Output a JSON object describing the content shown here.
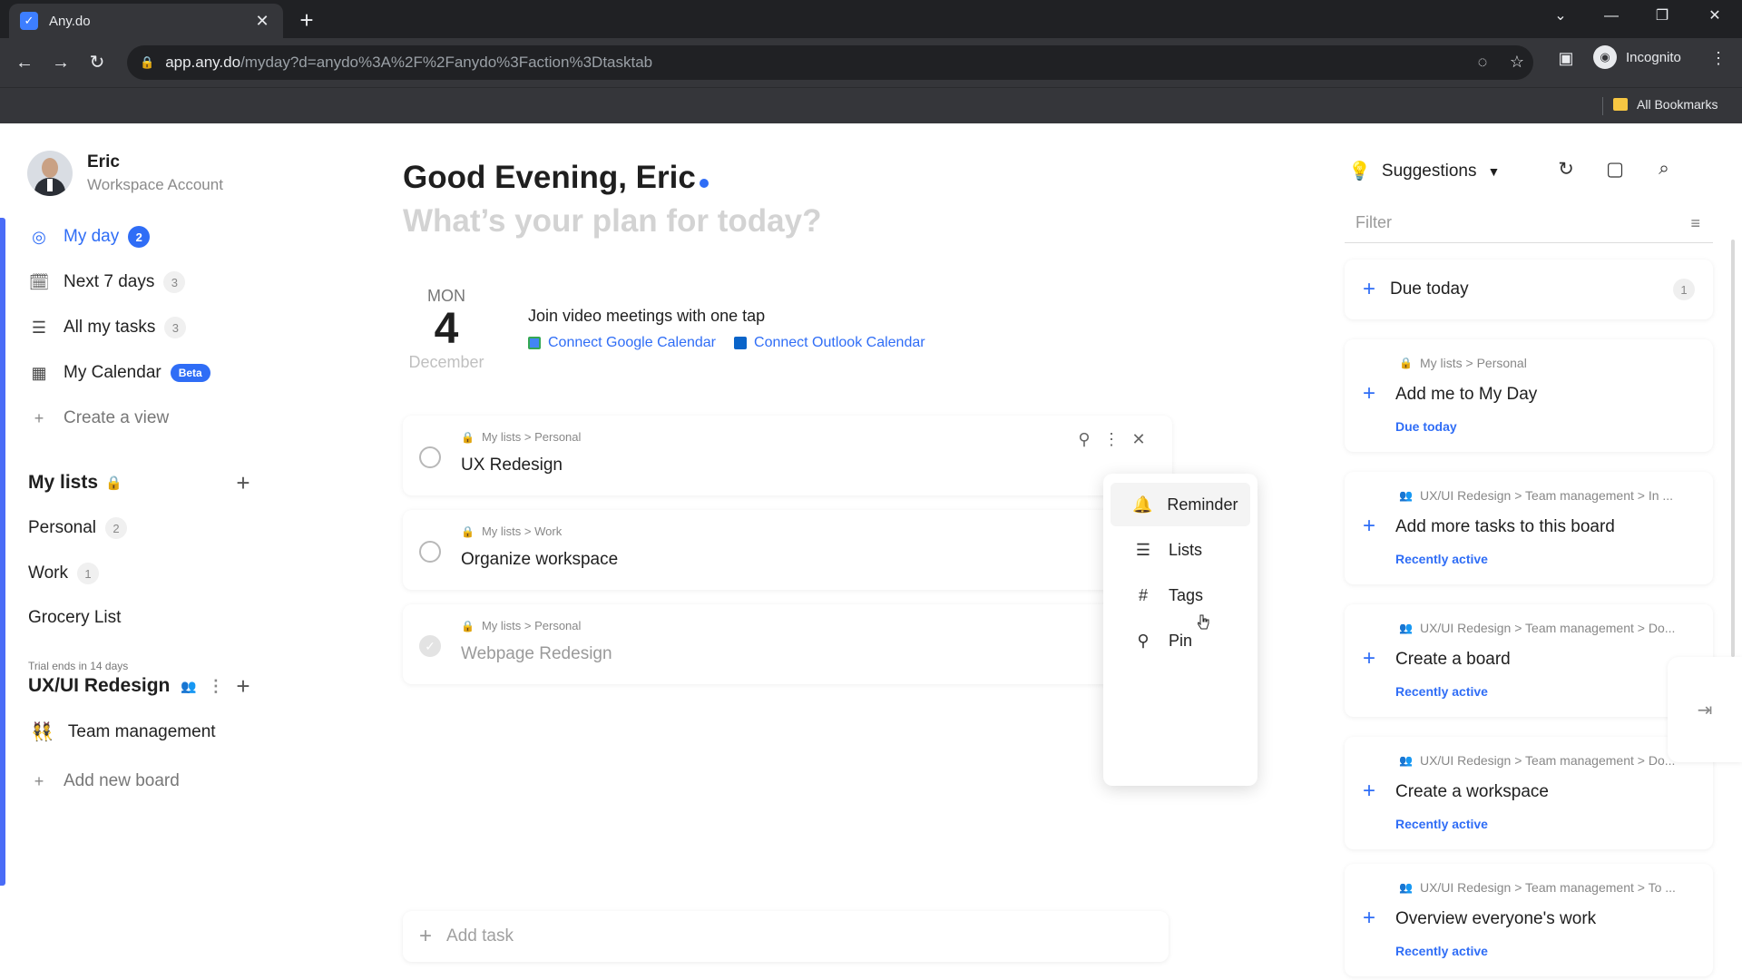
{
  "browser": {
    "tab_title": "Any.do",
    "url_host": "app.any.do",
    "url_path": "/myday?d=anydo%3A%2F%2Fanydo%3Faction%3Dtasktab",
    "incognito_label": "Incognito",
    "bookmarks_label": "All Bookmarks"
  },
  "user": {
    "name": "Eric",
    "account_type": "Workspace Account"
  },
  "nav": {
    "my_day": {
      "label": "My day",
      "count": "2"
    },
    "next_7_days": {
      "label": "Next 7 days",
      "count": "3"
    },
    "all_my_tasks": {
      "label": "All my tasks",
      "count": "3"
    },
    "my_calendar": {
      "label": "My Calendar",
      "badge": "Beta"
    },
    "create_view": "Create a view"
  },
  "my_lists": {
    "title": "My lists",
    "items": [
      {
        "label": "Personal",
        "count": "2"
      },
      {
        "label": "Work",
        "count": "1"
      },
      {
        "label": "Grocery List"
      }
    ]
  },
  "workspace": {
    "trial_text": "Trial ends in 14 days",
    "name": "UX/UI Redesign",
    "boards": [
      {
        "label": "Team management",
        "emoji": "👯"
      }
    ],
    "add_board": "Add new board"
  },
  "main": {
    "greeting": "Good Evening, Eric",
    "subtitle": "What’s your plan for today?",
    "date": {
      "dow": "MON",
      "day": "4",
      "month": "December"
    },
    "calendar_promo": {
      "title": "Join video meetings with one tap",
      "google": "Connect Google Calendar",
      "outlook": "Connect Outlook Calendar"
    },
    "tasks": [
      {
        "path": "My lists > Personal",
        "title": "UX Redesign",
        "done": false
      },
      {
        "path": "My lists > Work",
        "title": "Organize workspace",
        "done": false
      },
      {
        "path": "My lists > Personal",
        "title": "Webpage Redesign",
        "done": true
      }
    ],
    "add_task": "Add task"
  },
  "context_menu": {
    "items": [
      {
        "label": "Reminder",
        "icon": "bell-icon"
      },
      {
        "label": "Lists",
        "icon": "list-icon"
      },
      {
        "label": "Tags",
        "icon": "hash-icon"
      },
      {
        "label": "Pin",
        "icon": "pin-icon"
      }
    ]
  },
  "right_panel": {
    "suggestions_label": "Suggestions",
    "filter_placeholder": "Filter",
    "due_today": {
      "label": "Due today",
      "count": "1"
    },
    "cards": [
      {
        "path": "My lists > Personal",
        "title": "Add me to My Day",
        "status": "Due today",
        "shared": false
      },
      {
        "path": "UX/UI Redesign > Team management > In ...",
        "title": "Add more tasks to this board",
        "status": "Recently active",
        "shared": true
      },
      {
        "path": "UX/UI Redesign > Team management > Do...",
        "title": "Create a board",
        "status": "Recently active",
        "shared": true
      },
      {
        "path": "UX/UI Redesign > Team management > Do...",
        "title": "Create a workspace",
        "status": "Recently active",
        "shared": true
      },
      {
        "path": "UX/UI Redesign > Team management > To ...",
        "title": "Overview everyone's work",
        "status": "Recently active",
        "shared": true
      }
    ]
  },
  "colors": {
    "accent": "#2f6df6",
    "sidebar_accent": "#4a6cf7"
  }
}
